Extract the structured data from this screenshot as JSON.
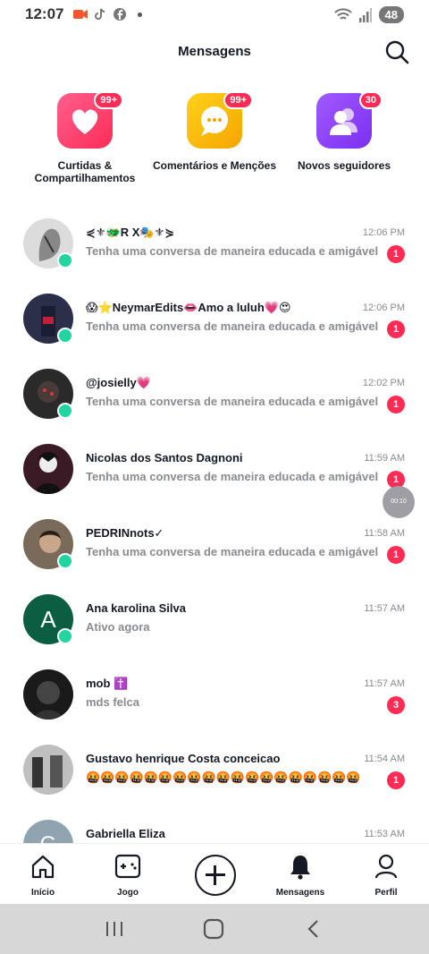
{
  "status_bar": {
    "time": "12:07",
    "battery": "48"
  },
  "header": {
    "title": "Mensagens"
  },
  "categories": [
    {
      "label": "Curtidas & Compartilhamentos",
      "badge": "99+",
      "icon": "heart-icon",
      "color": "#fe2c70"
    },
    {
      "label": "Comentários e Menções",
      "badge": "99+",
      "icon": "comment-icon",
      "color": "#f7b500"
    },
    {
      "label": "Novos seguidores",
      "badge": "30",
      "icon": "followers-icon",
      "color": "#8a3ff6"
    }
  ],
  "messages": [
    {
      "name": "⋞⚜🐲R X🎭⚜⋟",
      "preview": "Tenha uma conversa de maneira educada e amigável",
      "time": "12:06 PM",
      "unread": "1",
      "online": true,
      "avatar_color": "#dcdcdc",
      "avatar_letter": ""
    },
    {
      "name": "😱⭐NeymarEdits👄Amo a luluh💗😍",
      "preview": "Tenha uma conversa de maneira educada e amigável",
      "time": "12:06 PM",
      "unread": "1",
      "online": true,
      "avatar_color": "#2b2f4a",
      "avatar_letter": ""
    },
    {
      "name": "@josielly💗",
      "preview": "Tenha uma conversa de maneira educada e amigável",
      "time": "12:02 PM",
      "unread": "1",
      "online": true,
      "avatar_color": "#2a2a2a",
      "avatar_letter": ""
    },
    {
      "name": "Nicolas dos Santos Dagnoni",
      "preview": "Tenha uma conversa de maneira educada e amigável",
      "time": "11:59 AM",
      "unread": "1",
      "online": false,
      "avatar_color": "#3a1a24",
      "avatar_letter": ""
    },
    {
      "name": "PEDRINnots✓",
      "preview": "Tenha uma conversa de maneira educada e amigável",
      "time": "11:58 AM",
      "unread": "1",
      "online": true,
      "avatar_color": "#7a6a5a",
      "avatar_letter": ""
    },
    {
      "name": "Ana karolina Silva",
      "preview": "Ativo agora",
      "time": "11:57 AM",
      "unread": "",
      "online": true,
      "avatar_color": "#0c5e43",
      "avatar_letter": "A"
    },
    {
      "name": "mob ✝️",
      "preview": "mds felca",
      "time": "11:57 AM",
      "unread": "3",
      "online": false,
      "avatar_color": "#1a1a1a",
      "avatar_letter": ""
    },
    {
      "name": "Gustavo henrique Costa conceicao",
      "preview": "🤬🤬🤬🤬🤬🤬🤬🤬🤬🤬🤬🤬🤬🤬🤬🤬🤬🤬🤬",
      "time": "11:54 AM",
      "unread": "1",
      "online": false,
      "avatar_color": "#bfbfbf",
      "avatar_letter": ""
    },
    {
      "name": "Gabriella Eliza",
      "preview": "",
      "time": "11:53 AM",
      "unread": "",
      "online": false,
      "avatar_color": "#8fa3b0",
      "avatar_letter": "G"
    }
  ],
  "floating_bubble": {
    "label": "00:10"
  },
  "bottom_nav": [
    {
      "label": "Início",
      "icon": "home-icon"
    },
    {
      "label": "Jogo",
      "icon": "game-icon"
    },
    {
      "label": "",
      "icon": "plus-icon"
    },
    {
      "label": "Mensagens",
      "icon": "bell-icon"
    },
    {
      "label": "Perfil",
      "icon": "profile-icon"
    }
  ]
}
